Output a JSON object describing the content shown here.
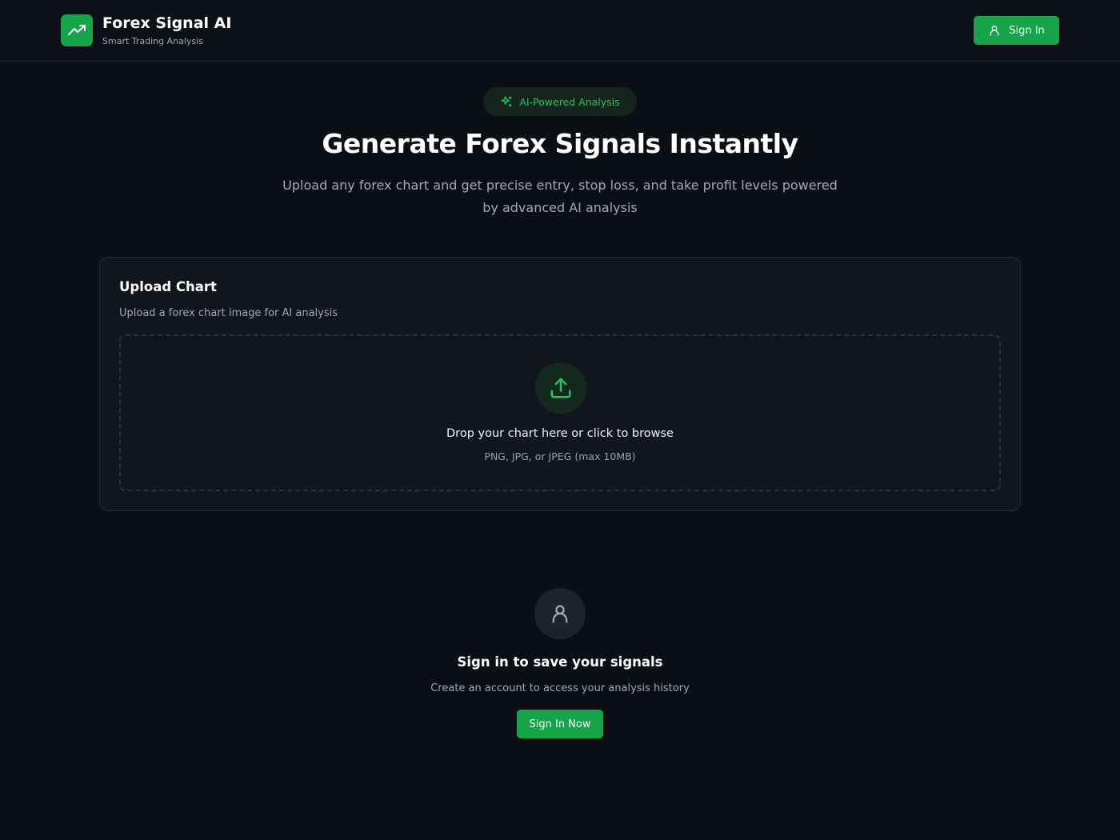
{
  "header": {
    "brand_title": "Forex Signal AI",
    "brand_subtitle": "Smart Trading Analysis",
    "logo_icon": "trending-up-icon",
    "sign_in_label": "Sign In"
  },
  "hero": {
    "badge_label": "AI-Powered Analysis",
    "title": "Generate Forex Signals Instantly",
    "description": "Upload any forex chart and get precise entry, stop loss, and take profit levels powered by advanced AI analysis"
  },
  "upload_card": {
    "title": "Upload Chart",
    "subtitle": "Upload a forex chart image for AI analysis",
    "drop_text": "Drop your chart here or click to browse",
    "drop_hint": "PNG, JPG, or JPEG (max 10MB)"
  },
  "signin_prompt": {
    "title": "Sign in to save your signals",
    "subtitle": "Create an account to access your analysis history",
    "button_label": "Sign In Now"
  },
  "colors": {
    "accent": "#16a34a",
    "accent_text": "#22c55e",
    "background": "#0b0e14",
    "card": "#12151d"
  }
}
